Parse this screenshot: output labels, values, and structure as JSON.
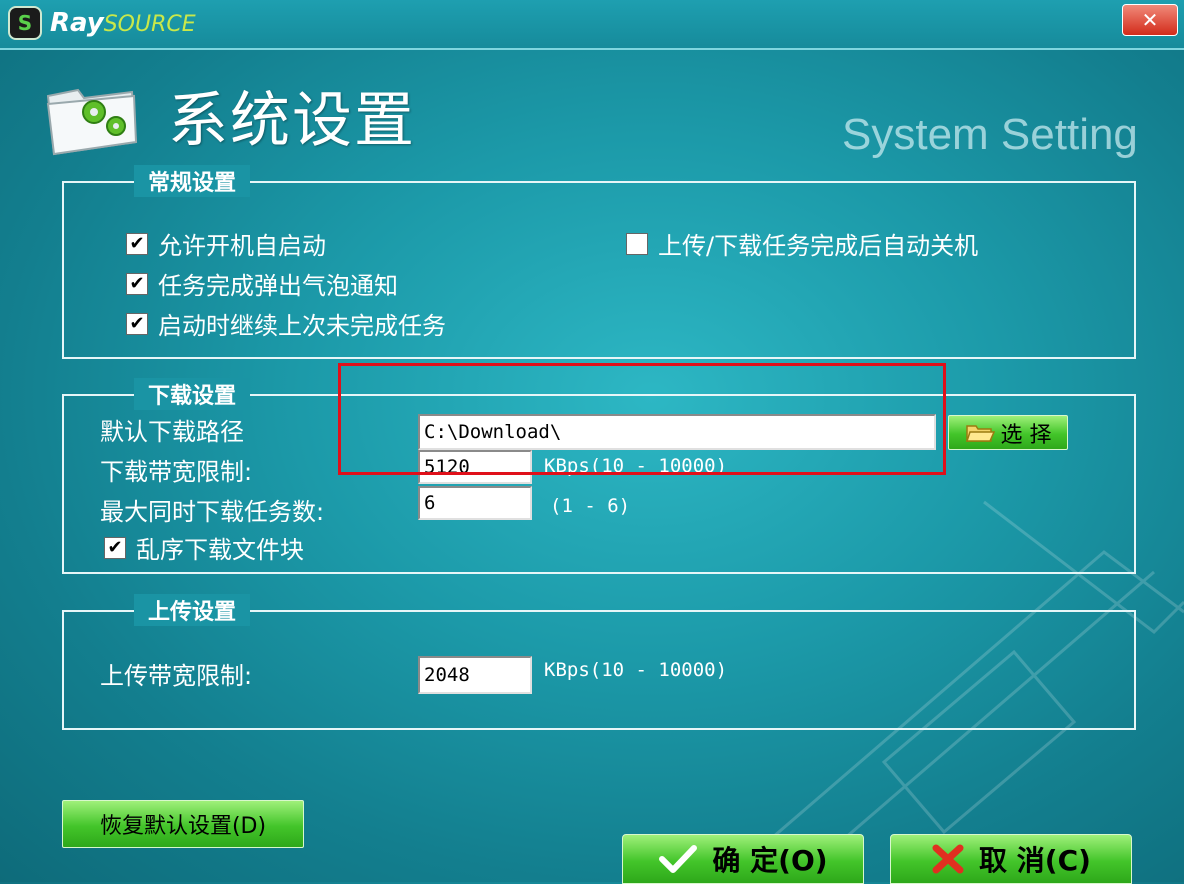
{
  "window": {
    "logo_mark": "S",
    "logo_word": "Ray",
    "logo_word_b": "SOURCE",
    "close_glyph": "✕",
    "title": "系统设置",
    "subtitle": "System Setting"
  },
  "general": {
    "legend": "常规设置",
    "autostart": {
      "label": "允许开机自启动",
      "checked": true
    },
    "balloon": {
      "label": "任务完成弹出气泡通知",
      "checked": true
    },
    "resume": {
      "label": "启动时继续上次未完成任务",
      "checked": true
    },
    "shutdown": {
      "label": "上传/下载任务完成后自动关机",
      "checked": false
    }
  },
  "download": {
    "legend": "下载设置",
    "path_label": "默认下载路径",
    "path_value": "C:\\Download\\",
    "browse_label": "选 择",
    "bandwidth_label": "下载带宽限制:",
    "bandwidth_value": "5120",
    "bandwidth_hint": "KBps(10 - 10000)",
    "max_tasks_label": "最大同时下载任务数:",
    "max_tasks_value": "6",
    "max_tasks_hint": "(1 - 6)",
    "shuffle": {
      "label": "乱序下载文件块",
      "checked": true
    }
  },
  "upload": {
    "legend": "上传设置",
    "bandwidth_label": "上传带宽限制:",
    "bandwidth_value": "2048",
    "bandwidth_hint": "KBps(10 - 10000)"
  },
  "footer": {
    "restore_label": "恢复默认设置(D)",
    "ok_label": "确 定(O)",
    "cancel_label": "取 消(C)"
  },
  "colors": {
    "background": "#1a94a4",
    "accent_green": "#43c52a",
    "highlight_red": "#e0101a"
  },
  "icons": [
    "folder-gear-icon",
    "folder-open-icon",
    "check-icon",
    "cross-icon"
  ]
}
